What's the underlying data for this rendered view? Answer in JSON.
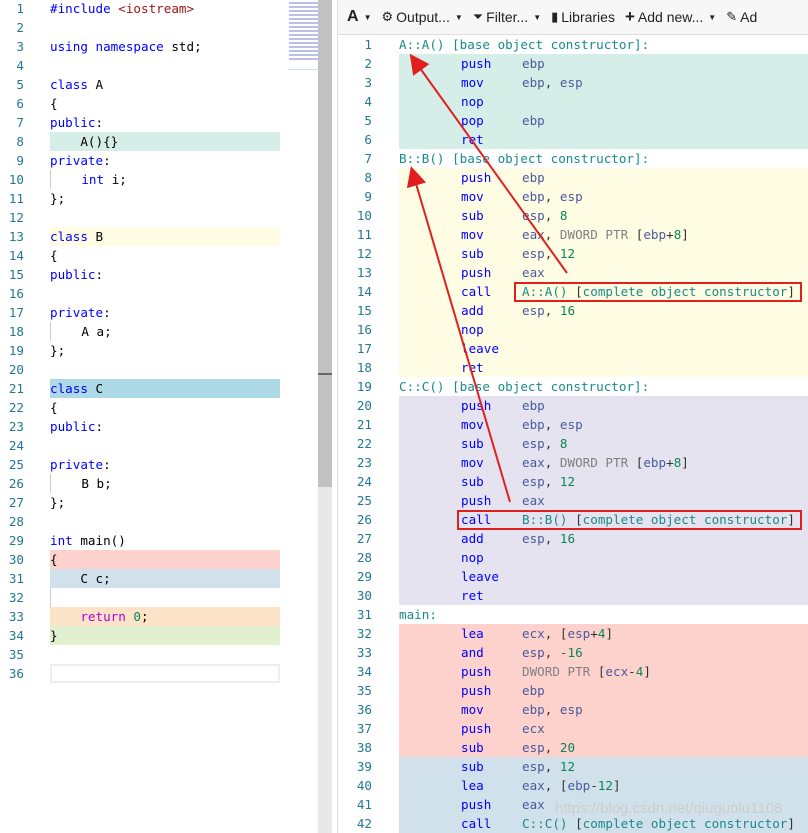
{
  "source": {
    "lines": [
      {
        "n": "1",
        "t": [
          [
            "pp",
            "#include "
          ],
          [
            "str",
            "<iostream>"
          ]
        ]
      },
      {
        "n": "2",
        "t": []
      },
      {
        "n": "3",
        "t": [
          [
            "kw",
            "using namespace "
          ],
          [
            "id",
            "std;"
          ]
        ]
      },
      {
        "n": "4",
        "t": []
      },
      {
        "n": "5",
        "t": [
          [
            "kw",
            "class "
          ],
          [
            "id",
            "A"
          ]
        ]
      },
      {
        "n": "6",
        "t": [
          [
            "id",
            "{"
          ]
        ]
      },
      {
        "n": "7",
        "t": [
          [
            "kw",
            "public"
          ],
          [
            "id",
            ":"
          ]
        ]
      },
      {
        "n": "8",
        "t": [
          [
            "id",
            "    A(){}"
          ]
        ],
        "bg": "#d5eee8"
      },
      {
        "n": "9",
        "t": [
          [
            "kw",
            "private"
          ],
          [
            "id",
            ":"
          ]
        ]
      },
      {
        "n": "10",
        "t": [
          [
            "id",
            "    "
          ],
          [
            "kw",
            "int "
          ],
          [
            "id",
            "i;"
          ]
        ],
        "indent": true
      },
      {
        "n": "11",
        "t": [
          [
            "id",
            "};"
          ]
        ]
      },
      {
        "n": "12",
        "t": []
      },
      {
        "n": "13",
        "t": [
          [
            "kw",
            "class "
          ],
          [
            "id",
            "B"
          ]
        ],
        "bg": "#fefde4"
      },
      {
        "n": "14",
        "t": [
          [
            "id",
            "{"
          ]
        ]
      },
      {
        "n": "15",
        "t": [
          [
            "kw",
            "public"
          ],
          [
            "id",
            ":"
          ]
        ]
      },
      {
        "n": "16",
        "t": []
      },
      {
        "n": "17",
        "t": [
          [
            "kw",
            "private"
          ],
          [
            "id",
            ":"
          ]
        ]
      },
      {
        "n": "18",
        "t": [
          [
            "id",
            "    A a;"
          ]
        ],
        "indent": true
      },
      {
        "n": "19",
        "t": [
          [
            "id",
            "};"
          ]
        ]
      },
      {
        "n": "20",
        "t": []
      },
      {
        "n": "21",
        "t": [
          [
            "kw",
            "class "
          ],
          [
            "id",
            "C"
          ]
        ],
        "bg": "#add8e6"
      },
      {
        "n": "22",
        "t": [
          [
            "id",
            "{"
          ]
        ]
      },
      {
        "n": "23",
        "t": [
          [
            "kw",
            "public"
          ],
          [
            "id",
            ":"
          ]
        ]
      },
      {
        "n": "24",
        "t": []
      },
      {
        "n": "25",
        "t": [
          [
            "kw",
            "private"
          ],
          [
            "id",
            ":"
          ]
        ]
      },
      {
        "n": "26",
        "t": [
          [
            "id",
            "    B b;"
          ]
        ],
        "indent": true
      },
      {
        "n": "27",
        "t": [
          [
            "id",
            "};"
          ]
        ]
      },
      {
        "n": "28",
        "t": []
      },
      {
        "n": "29",
        "t": [
          [
            "kw",
            "int "
          ],
          [
            "id",
            "main()"
          ]
        ]
      },
      {
        "n": "30",
        "t": [
          [
            "id",
            "{"
          ]
        ],
        "bg": "#fdd2cd"
      },
      {
        "n": "31",
        "t": [
          [
            "id",
            "    C c;"
          ]
        ],
        "bg": "#d1e1ec"
      },
      {
        "n": "32",
        "t": [],
        "indent": true
      },
      {
        "n": "33",
        "t": [
          [
            "id",
            "    "
          ],
          [
            "ret",
            "return "
          ],
          [
            "num",
            "0"
          ],
          [
            "id",
            ";"
          ]
        ],
        "bg": "#fce3c8"
      },
      {
        "n": "34",
        "t": [
          [
            "id",
            "}"
          ]
        ],
        "bg": "#e2f0d0"
      },
      {
        "n": "35",
        "t": []
      },
      {
        "n": "36",
        "t": [],
        "cur": true
      }
    ]
  },
  "toolbar": {
    "font_label": "A",
    "output_label": "Output...",
    "filter_label": "Filter...",
    "libraries_label": "Libraries",
    "add_new_label": "Add new...",
    "add_tool_label": "Ad"
  },
  "asm": {
    "lines": [
      {
        "n": "1",
        "label": "A::A() [base object constructor]:"
      },
      {
        "n": "2",
        "op": "push",
        "a": [
          [
            "reg",
            "ebp"
          ]
        ],
        "bg": "#d5eee8"
      },
      {
        "n": "3",
        "op": "mov",
        "a": [
          [
            "reg",
            "ebp"
          ],
          [
            "br",
            ", "
          ],
          [
            "reg",
            "esp"
          ]
        ],
        "bg": "#d5eee8"
      },
      {
        "n": "4",
        "op": "nop",
        "a": [],
        "bg": "#d5eee8"
      },
      {
        "n": "5",
        "op": "pop",
        "a": [
          [
            "reg",
            "ebp"
          ]
        ],
        "bg": "#d5eee8"
      },
      {
        "n": "6",
        "op": "ret",
        "a": [],
        "bg": "#d5eee8"
      },
      {
        "n": "7",
        "label": "B::B() [base object constructor]:"
      },
      {
        "n": "8",
        "op": "push",
        "a": [
          [
            "reg",
            "ebp"
          ]
        ],
        "bg": "#fefde4"
      },
      {
        "n": "9",
        "op": "mov",
        "a": [
          [
            "reg",
            "ebp"
          ],
          [
            "br",
            ", "
          ],
          [
            "reg",
            "esp"
          ]
        ],
        "bg": "#fefde4"
      },
      {
        "n": "10",
        "op": "sub",
        "a": [
          [
            "reg",
            "esp"
          ],
          [
            "br",
            ", "
          ],
          [
            "num",
            "8"
          ]
        ],
        "bg": "#fefde4"
      },
      {
        "n": "11",
        "op": "mov",
        "a": [
          [
            "reg",
            "eax"
          ],
          [
            "br",
            ", "
          ],
          [
            "ptr",
            "DWORD PTR "
          ],
          [
            "br",
            "["
          ],
          [
            "reg",
            "ebp"
          ],
          [
            "br",
            "+"
          ],
          [
            "num",
            "8"
          ],
          [
            "br",
            "]"
          ]
        ],
        "bg": "#fefde4"
      },
      {
        "n": "12",
        "op": "sub",
        "a": [
          [
            "reg",
            "esp"
          ],
          [
            "br",
            ", "
          ],
          [
            "num",
            "12"
          ]
        ],
        "bg": "#fefde4"
      },
      {
        "n": "13",
        "op": "push",
        "a": [
          [
            "reg",
            "eax"
          ]
        ],
        "bg": "#fefde4"
      },
      {
        "n": "14",
        "op": "call",
        "a": [
          [
            "sym",
            "A::A() "
          ],
          [
            "br",
            "["
          ],
          [
            "sym",
            "complete object constructor"
          ],
          [
            "br",
            "]"
          ]
        ],
        "bg": "#fefde4"
      },
      {
        "n": "15",
        "op": "add",
        "a": [
          [
            "reg",
            "esp"
          ],
          [
            "br",
            ", "
          ],
          [
            "num",
            "16"
          ]
        ],
        "bg": "#fefde4"
      },
      {
        "n": "16",
        "op": "nop",
        "a": [],
        "bg": "#fefde4"
      },
      {
        "n": "17",
        "op": "leave",
        "a": [],
        "bg": "#fefde4"
      },
      {
        "n": "18",
        "op": "ret",
        "a": [],
        "bg": "#fefde4"
      },
      {
        "n": "19",
        "label": "C::C() [base object constructor]:"
      },
      {
        "n": "20",
        "op": "push",
        "a": [
          [
            "reg",
            "ebp"
          ]
        ],
        "bg": "#e4e3ef"
      },
      {
        "n": "21",
        "op": "mov",
        "a": [
          [
            "reg",
            "ebp"
          ],
          [
            "br",
            ", "
          ],
          [
            "reg",
            "esp"
          ]
        ],
        "bg": "#e4e3ef"
      },
      {
        "n": "22",
        "op": "sub",
        "a": [
          [
            "reg",
            "esp"
          ],
          [
            "br",
            ", "
          ],
          [
            "num",
            "8"
          ]
        ],
        "bg": "#e4e3ef"
      },
      {
        "n": "23",
        "op": "mov",
        "a": [
          [
            "reg",
            "eax"
          ],
          [
            "br",
            ", "
          ],
          [
            "ptr",
            "DWORD PTR "
          ],
          [
            "br",
            "["
          ],
          [
            "reg",
            "ebp"
          ],
          [
            "br",
            "+"
          ],
          [
            "num",
            "8"
          ],
          [
            "br",
            "]"
          ]
        ],
        "bg": "#e4e3ef"
      },
      {
        "n": "24",
        "op": "sub",
        "a": [
          [
            "reg",
            "esp"
          ],
          [
            "br",
            ", "
          ],
          [
            "num",
            "12"
          ]
        ],
        "bg": "#e4e3ef"
      },
      {
        "n": "25",
        "op": "push",
        "a": [
          [
            "reg",
            "eax"
          ]
        ],
        "bg": "#e4e3ef"
      },
      {
        "n": "26",
        "op": "call",
        "a": [
          [
            "sym",
            "B::B() "
          ],
          [
            "br",
            "["
          ],
          [
            "sym",
            "complete object constructor"
          ],
          [
            "br",
            "]"
          ]
        ],
        "bg": "#e4e3ef"
      },
      {
        "n": "27",
        "op": "add",
        "a": [
          [
            "reg",
            "esp"
          ],
          [
            "br",
            ", "
          ],
          [
            "num",
            "16"
          ]
        ],
        "bg": "#e4e3ef"
      },
      {
        "n": "28",
        "op": "nop",
        "a": [],
        "bg": "#e4e3ef"
      },
      {
        "n": "29",
        "op": "leave",
        "a": [],
        "bg": "#e4e3ef"
      },
      {
        "n": "30",
        "op": "ret",
        "a": [],
        "bg": "#e4e3ef"
      },
      {
        "n": "31",
        "label": "main:"
      },
      {
        "n": "32",
        "op": "lea",
        "a": [
          [
            "reg",
            "ecx"
          ],
          [
            "br",
            ", ["
          ],
          [
            "reg",
            "esp"
          ],
          [
            "br",
            "+"
          ],
          [
            "num",
            "4"
          ],
          [
            "br",
            "]"
          ]
        ],
        "bg": "#fdd2cd"
      },
      {
        "n": "33",
        "op": "and",
        "a": [
          [
            "reg",
            "esp"
          ],
          [
            "br",
            ", "
          ],
          [
            "num",
            "-16"
          ]
        ],
        "bg": "#fdd2cd"
      },
      {
        "n": "34",
        "op": "push",
        "a": [
          [
            "ptr",
            "DWORD PTR "
          ],
          [
            "br",
            "["
          ],
          [
            "reg",
            "ecx"
          ],
          [
            "br",
            "-"
          ],
          [
            "num",
            "4"
          ],
          [
            "br",
            "]"
          ]
        ],
        "bg": "#fdd2cd"
      },
      {
        "n": "35",
        "op": "push",
        "a": [
          [
            "reg",
            "ebp"
          ]
        ],
        "bg": "#fdd2cd"
      },
      {
        "n": "36",
        "op": "mov",
        "a": [
          [
            "reg",
            "ebp"
          ],
          [
            "br",
            ", "
          ],
          [
            "reg",
            "esp"
          ]
        ],
        "bg": "#fdd2cd"
      },
      {
        "n": "37",
        "op": "push",
        "a": [
          [
            "reg",
            "ecx"
          ]
        ],
        "bg": "#fdd2cd"
      },
      {
        "n": "38",
        "op": "sub",
        "a": [
          [
            "reg",
            "esp"
          ],
          [
            "br",
            ", "
          ],
          [
            "num",
            "20"
          ]
        ],
        "bg": "#fdd2cd"
      },
      {
        "n": "39",
        "op": "sub",
        "a": [
          [
            "reg",
            "esp"
          ],
          [
            "br",
            ", "
          ],
          [
            "num",
            "12"
          ]
        ],
        "bg": "#d1e1ec"
      },
      {
        "n": "40",
        "op": "lea",
        "a": [
          [
            "reg",
            "eax"
          ],
          [
            "br",
            ", ["
          ],
          [
            "reg",
            "ebp"
          ],
          [
            "br",
            "-"
          ],
          [
            "num",
            "12"
          ],
          [
            "br",
            "]"
          ]
        ],
        "bg": "#d1e1ec"
      },
      {
        "n": "41",
        "op": "push",
        "a": [
          [
            "reg",
            "eax"
          ]
        ],
        "bg": "#d1e1ec"
      },
      {
        "n": "42",
        "op": "call",
        "a": [
          [
            "sym",
            "C::C() "
          ],
          [
            "br",
            "["
          ],
          [
            "sym",
            "complete object constructor"
          ],
          [
            "br",
            "]"
          ]
        ],
        "bg": "#d1e1ec"
      }
    ]
  },
  "annotations": {
    "arrow_color": "#e02020",
    "box_color": "#e02020"
  },
  "watermark": "https://blog.csdn.net/qiuguolu1108"
}
